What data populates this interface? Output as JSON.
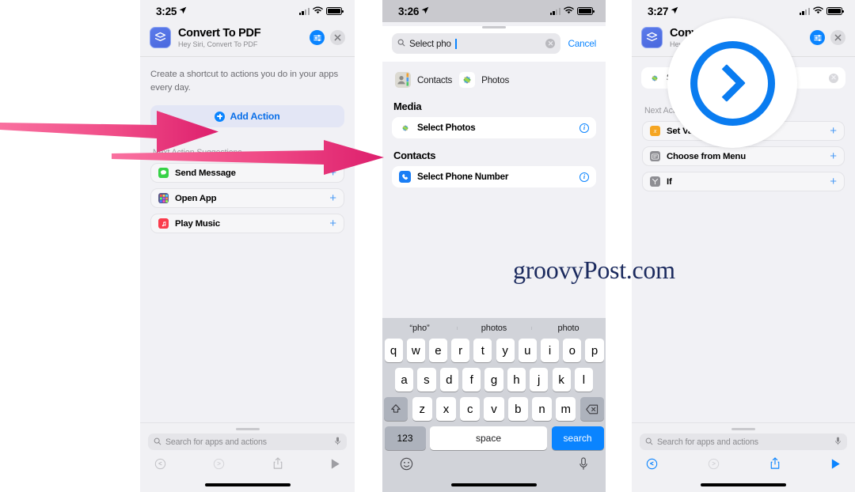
{
  "panels": [
    {
      "id": "panel-1",
      "status": {
        "time": "3:25"
      },
      "shortcut": {
        "title": "Convert To PDF",
        "subtitle": "Hey Siri, Convert To PDF"
      },
      "description": "Create a shortcut to actions you do in your apps every day.",
      "add_action_label": "Add Action",
      "suggestions_header": "Next Action Suggestions",
      "suggestions": [
        {
          "label": "Send Message",
          "icon": "messages-icon",
          "color": "#37d247",
          "plus": "+"
        },
        {
          "label": "Open App",
          "icon": "open-app-icon",
          "color": "#6e6e9e",
          "plus": "+"
        },
        {
          "label": "Play Music",
          "icon": "music-icon",
          "color": "#fa3b4c",
          "plus": "+"
        }
      ],
      "search_placeholder": "Search for apps and actions",
      "toolbar": {
        "undo": "undo-icon",
        "redo": "redo-icon",
        "share": "share-icon",
        "play": "play-icon",
        "active": false
      }
    },
    {
      "id": "panel-2",
      "status": {
        "time": "3:26"
      },
      "search_value": "Select pho",
      "cancel_label": "Cancel",
      "app_chips": [
        {
          "label": "Contacts",
          "icon": "contacts-app-icon"
        },
        {
          "label": "Photos",
          "icon": "photos-app-icon"
        }
      ],
      "groups": [
        {
          "header": "Media",
          "rows": [
            {
              "label": "Select Photos",
              "icon": "photos-app-icon",
              "info": "info-icon"
            }
          ]
        },
        {
          "header": "Contacts",
          "rows": [
            {
              "label": "Select Phone Number",
              "icon": "phone-app-icon",
              "info": "info-icon"
            }
          ]
        }
      ],
      "keyboard": {
        "predictions": [
          "“pho”",
          "photos",
          "photo"
        ],
        "row1": [
          "q",
          "w",
          "e",
          "r",
          "t",
          "y",
          "u",
          "i",
          "o",
          "p"
        ],
        "row2": [
          "a",
          "s",
          "d",
          "f",
          "g",
          "h",
          "j",
          "k",
          "l"
        ],
        "row3": [
          "z",
          "x",
          "c",
          "v",
          "b",
          "n",
          "m"
        ],
        "shift": "shift-icon",
        "backspace": "backspace-icon",
        "numbers_label": "123",
        "space_label": "space",
        "return_label": "search",
        "emoji": "emoji-icon",
        "dictation": "microphone-icon"
      }
    },
    {
      "id": "panel-3",
      "status": {
        "time": "3:27"
      },
      "shortcut": {
        "title": "Conv",
        "subtitle": "Hey S"
      },
      "first_row_label": "Se",
      "suggestions_header": "Next Action S",
      "suggestions": [
        {
          "label": "Set Variable",
          "icon": "set-variable-icon",
          "color": "#f5a623",
          "plus": "+"
        },
        {
          "label": "Choose from Menu",
          "icon": "choose-menu-icon",
          "color": "#8e8e93",
          "plus": "+"
        },
        {
          "label": "If",
          "icon": "if-icon",
          "color": "#8e8e93",
          "plus": "+"
        }
      ],
      "search_placeholder": "Search for apps and actions",
      "toolbar": {
        "undo": "undo-icon",
        "redo": "redo-icon",
        "share": "share-icon",
        "play": "play-icon",
        "active": true
      },
      "magnifier": {
        "icon": "chevron-right-circle-icon",
        "color": "#0a7cf0"
      }
    }
  ],
  "annotations": {
    "arrow_color_light": "#f4558c",
    "arrow_color_dark": "#d8226b"
  },
  "watermark": "groovyPost.com"
}
